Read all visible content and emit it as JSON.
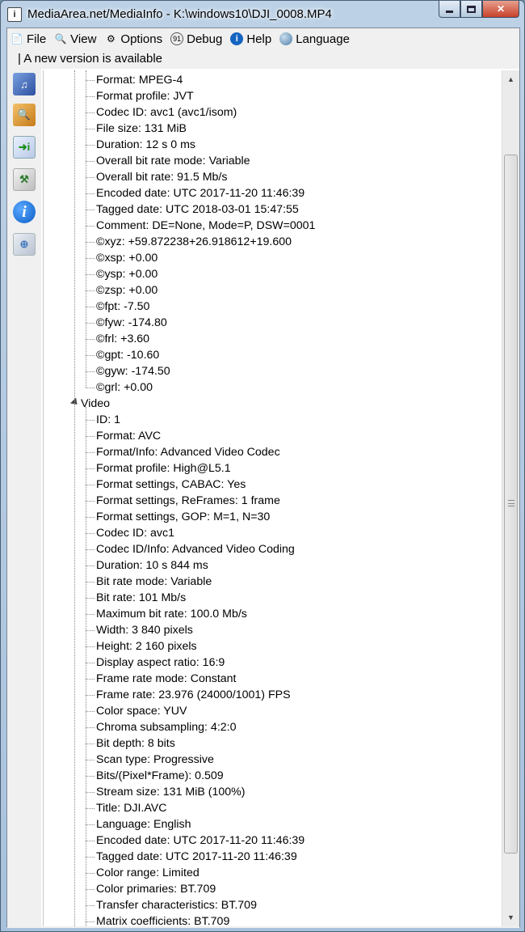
{
  "window": {
    "title": "MediaArea.net/MediaInfo - K:\\windows10\\DJI_0008.MP4",
    "app_icon": "mediainfo-icon"
  },
  "menu": [
    {
      "label": "File",
      "icon": "file-icon"
    },
    {
      "label": "View",
      "icon": "view-icon"
    },
    {
      "label": "Options",
      "icon": "options-icon"
    },
    {
      "label": "Debug",
      "icon": "debug-icon"
    },
    {
      "label": "Help",
      "icon": "help-icon"
    },
    {
      "label": "Language",
      "icon": "language-icon"
    }
  ],
  "notice": "| A new version is available",
  "toolbar": [
    {
      "name": "open-file",
      "icon": "open-file-icon"
    },
    {
      "name": "open-folder",
      "icon": "open-folder-icon"
    },
    {
      "name": "export",
      "icon": "export-icon"
    },
    {
      "name": "preferences",
      "icon": "settings-icon"
    },
    {
      "name": "about",
      "icon": "info-icon"
    },
    {
      "name": "web",
      "icon": "web-icon"
    }
  ],
  "general_items": [
    "Format: MPEG-4",
    "Format profile: JVT",
    "Codec ID: avc1 (avc1/isom)",
    "File size: 131 MiB",
    "Duration: 12 s 0 ms",
    "Overall bit rate mode: Variable",
    "Overall bit rate: 91.5 Mb/s",
    "Encoded date: UTC 2017-11-20 11:46:39",
    "Tagged date: UTC 2018-03-01 15:47:55",
    "Comment: DE=None, Mode=P, DSW=0001",
    "©xyz: +59.872238+26.918612+19.600",
    "©xsp: +0.00",
    "©ysp: +0.00",
    "©zsp: +0.00",
    "©fpt: -7.50",
    "©fyw: -174.80",
    "©frl: +3.60",
    "©gpt: -10.60",
    "©gyw: -174.50",
    "©grl: +0.00"
  ],
  "video_section": "Video",
  "video_items": [
    "ID: 1",
    "Format: AVC",
    "Format/Info: Advanced Video Codec",
    "Format profile: High@L5.1",
    "Format settings, CABAC: Yes",
    "Format settings, ReFrames: 1 frame",
    "Format settings, GOP: M=1, N=30",
    "Codec ID: avc1",
    "Codec ID/Info: Advanced Video Coding",
    "Duration: 10 s 844 ms",
    "Bit rate mode: Variable",
    "Bit rate: 101 Mb/s",
    "Maximum bit rate: 100.0 Mb/s",
    "Width: 3 840 pixels",
    "Height: 2 160 pixels",
    "Display aspect ratio: 16:9",
    "Frame rate mode: Constant",
    "Frame rate: 23.976 (24000/1001) FPS",
    "Color space: YUV",
    "Chroma subsampling: 4:2:0",
    "Bit depth: 8 bits",
    "Scan type: Progressive",
    "Bits/(Pixel*Frame): 0.509",
    "Stream size: 131 MiB (100%)",
    "Title: DJI.AVC",
    "Language: English",
    "Encoded date: UTC 2017-11-20 11:46:39",
    "Tagged date: UTC 2017-11-20 11:46:39",
    "Color range: Limited",
    "Color primaries: BT.709",
    "Transfer characteristics: BT.709",
    "Matrix coefficients: BT.709"
  ]
}
